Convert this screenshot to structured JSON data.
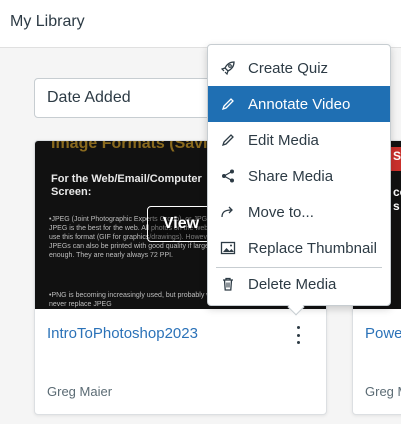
{
  "header": {
    "title": "My Library"
  },
  "sort": {
    "selected": "Date Added"
  },
  "cards": [
    {
      "title": "IntroToPhotoshop2023",
      "author": "Greg Maier",
      "view_label": "View",
      "thumbnail": {
        "heading": "Image Formats (Saving)",
        "subheading": "For the Web/Email/Computer Screen:",
        "bullet1": "•JPEG (Joint Photographic Experts Group), or JPG: JPEG is the best for the web. All photos on the web use this format (GIF for graphics/drawings). However, JPEGs can also be printed with good quality if large enough. They are nearly always 72 PPI.",
        "bullet2": "•PNG is becoming increasingly used, but probably will never replace JPEG"
      }
    },
    {
      "title": "Powe",
      "author": "Greg M",
      "thumbnail": {
        "text1": "Sa",
        "text2": "co s"
      }
    }
  ],
  "menu": {
    "items": [
      {
        "label": "Create Quiz",
        "icon": "rocket-icon"
      },
      {
        "label": "Annotate Video",
        "icon": "pencil-icon"
      },
      {
        "label": "Edit Media",
        "icon": "pencil-icon"
      },
      {
        "label": "Share Media",
        "icon": "share-icon"
      },
      {
        "label": "Move to...",
        "icon": "move-arrow-icon"
      },
      {
        "label": "Replace Thumbnail",
        "icon": "image-icon"
      },
      {
        "label": "Delete Media",
        "icon": "trash-icon"
      }
    ],
    "active_item": "Annotate Video",
    "accent": "#1f6fb3"
  },
  "colors": {
    "link": "#2b72b8",
    "text": "#2d3b45"
  }
}
